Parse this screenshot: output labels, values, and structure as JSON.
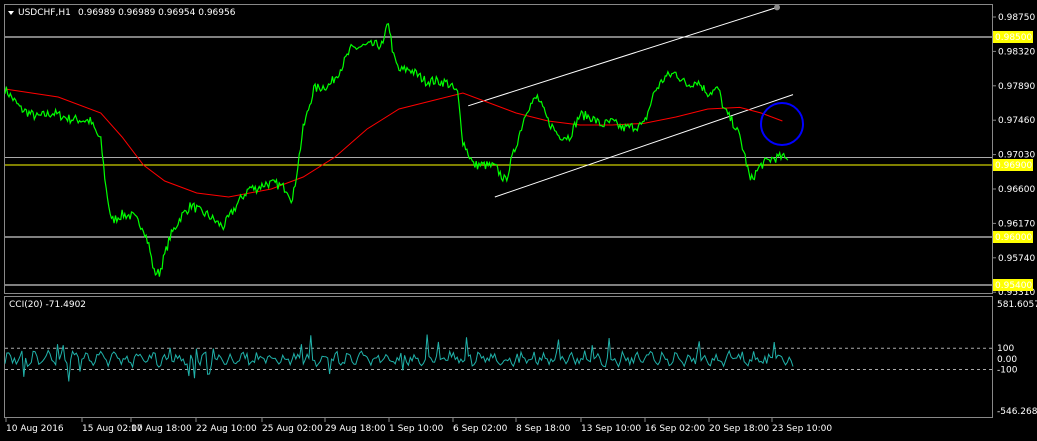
{
  "header": {
    "symbol": "USDCHF,H1",
    "ohlc": "0.96989 0.96989 0.96954 0.96956"
  },
  "indicator": {
    "label": "CCI(20) -71.4902",
    "levels": [
      "581.6057",
      "100",
      "0.00",
      "-100",
      "-546.2687"
    ]
  },
  "colors": {
    "background": "#000000",
    "price": "#00ff00",
    "moving_average": "#ff0000",
    "horizontal_levels": "#ffffff",
    "current_level": "#ffff00",
    "channel": "#ffffff",
    "cci": "#20b2aa",
    "marker_circle": "#0000ff",
    "level_tag": "#ffff00"
  },
  "chart_data": {
    "type": "line",
    "symbol": "USDCHF",
    "timeframe": "H1",
    "price_axis": {
      "ylim": [
        0.953,
        0.989
      ],
      "ticks": [
        0.9875,
        0.9832,
        0.9789,
        0.9746,
        0.9703,
        0.966,
        0.9617,
        0.9574,
        0.9531
      ]
    },
    "x_tick_labels": [
      "10 Aug 2016",
      "15 Aug 02:00",
      "17 Aug 18:00",
      "22 Aug 10:00",
      "25 Aug 02:00",
      "29 Aug 18:00",
      "1 Sep 10:00",
      "6 Sep 02:00",
      "8 Sep 18:00",
      "13 Sep 10:00",
      "16 Sep 02:00",
      "20 Sep 18:00",
      "23 Sep 10:00"
    ],
    "horizontal_levels": [
      {
        "value": 0.985,
        "label": "0.98500"
      },
      {
        "value": 0.969,
        "label": "0.96900"
      },
      {
        "value": 0.96,
        "label": "0.96000"
      },
      {
        "value": 0.954,
        "label": "0.95400"
      }
    ],
    "series": [
      {
        "name": "USDCHF",
        "points": [
          [
            0,
            0.9785
          ],
          [
            3,
            0.976
          ],
          [
            6,
            0.975
          ],
          [
            9,
            0.9755
          ],
          [
            12,
            0.9748
          ],
          [
            16,
            0.9745
          ],
          [
            18,
            0.972
          ],
          [
            19,
            0.966
          ],
          [
            20,
            0.962
          ],
          [
            22,
            0.9628
          ],
          [
            24,
            0.9626
          ],
          [
            26,
            0.9612
          ],
          [
            27,
            0.959
          ],
          [
            28,
            0.9556
          ],
          [
            29,
            0.9555
          ],
          [
            31,
            0.96
          ],
          [
            33,
            0.9625
          ],
          [
            35,
            0.964
          ],
          [
            37,
            0.963
          ],
          [
            38,
            0.9628
          ],
          [
            40,
            0.9617
          ],
          [
            41,
            0.9613
          ],
          [
            44,
            0.9645
          ],
          [
            46,
            0.9662
          ],
          [
            47,
            0.966
          ],
          [
            49,
            0.9667
          ],
          [
            51,
            0.9666
          ],
          [
            53,
            0.966
          ],
          [
            54,
            0.9645
          ],
          [
            56,
            0.9735
          ],
          [
            58,
            0.9785
          ],
          [
            61,
            0.979
          ],
          [
            63,
            0.981
          ],
          [
            65,
            0.9835
          ],
          [
            67,
            0.9838
          ],
          [
            69,
            0.984
          ],
          [
            71,
            0.984
          ],
          [
            72,
            0.987
          ],
          [
            73,
            0.9825
          ],
          [
            74,
            0.9808
          ],
          [
            76,
            0.981
          ],
          [
            78,
            0.98
          ],
          [
            79,
            0.9795
          ],
          [
            81,
            0.9795
          ],
          [
            83,
            0.9793
          ],
          [
            85,
            0.978
          ],
          [
            86,
            0.972
          ],
          [
            88,
            0.969
          ],
          [
            90,
            0.969
          ],
          [
            92,
            0.9688
          ],
          [
            94,
            0.967
          ],
          [
            96,
            0.9715
          ],
          [
            98,
            0.976
          ],
          [
            100,
            0.9775
          ],
          [
            102,
            0.9745
          ],
          [
            104,
            0.9727
          ],
          [
            106,
            0.9725
          ],
          [
            108,
            0.9753
          ],
          [
            110,
            0.975
          ],
          [
            112,
            0.974
          ],
          [
            114,
            0.9744
          ],
          [
            116,
            0.9736
          ],
          [
            118,
            0.9738
          ],
          [
            120,
            0.974
          ],
          [
            122,
            0.9782
          ],
          [
            124,
            0.98
          ],
          [
            126,
            0.9805
          ],
          [
            128,
            0.979
          ],
          [
            130,
            0.9795
          ],
          [
            132,
            0.978
          ],
          [
            134,
            0.9785
          ],
          [
            135,
            0.976
          ],
          [
            137,
            0.974
          ],
          [
            138,
            0.9725
          ],
          [
            139,
            0.97
          ],
          [
            140,
            0.967
          ],
          [
            142,
            0.969
          ],
          [
            144,
            0.9698
          ],
          [
            146,
            0.97
          ],
          [
            147,
            0.9696
          ]
        ]
      },
      {
        "name": "MA",
        "points": [
          [
            0,
            0.9785
          ],
          [
            10,
            0.9775
          ],
          [
            18,
            0.9755
          ],
          [
            22,
            0.9725
          ],
          [
            26,
            0.969
          ],
          [
            30,
            0.967
          ],
          [
            36,
            0.9655
          ],
          [
            42,
            0.965
          ],
          [
            50,
            0.966
          ],
          [
            56,
            0.9675
          ],
          [
            62,
            0.97
          ],
          [
            68,
            0.9735
          ],
          [
            74,
            0.976
          ],
          [
            80,
            0.977
          ],
          [
            86,
            0.978
          ],
          [
            90,
            0.977
          ],
          [
            96,
            0.9755
          ],
          [
            102,
            0.9745
          ],
          [
            108,
            0.974
          ],
          [
            114,
            0.974
          ],
          [
            120,
            0.9742
          ],
          [
            126,
            0.975
          ],
          [
            132,
            0.976
          ],
          [
            138,
            0.9762
          ],
          [
            142,
            0.9755
          ],
          [
            146,
            0.9745
          ]
        ]
      }
    ],
    "channel": {
      "lower": [
        [
          92,
          0.965
        ],
        [
          148,
          0.9778
        ]
      ],
      "upper": [
        [
          87,
          0.9764
        ],
        [
          145,
          0.9887
        ]
      ]
    },
    "cci": {
      "ylim": [
        -546.2687,
        581.6057
      ],
      "levels": [
        100,
        0,
        -100
      ],
      "last": -71.4902
    }
  }
}
